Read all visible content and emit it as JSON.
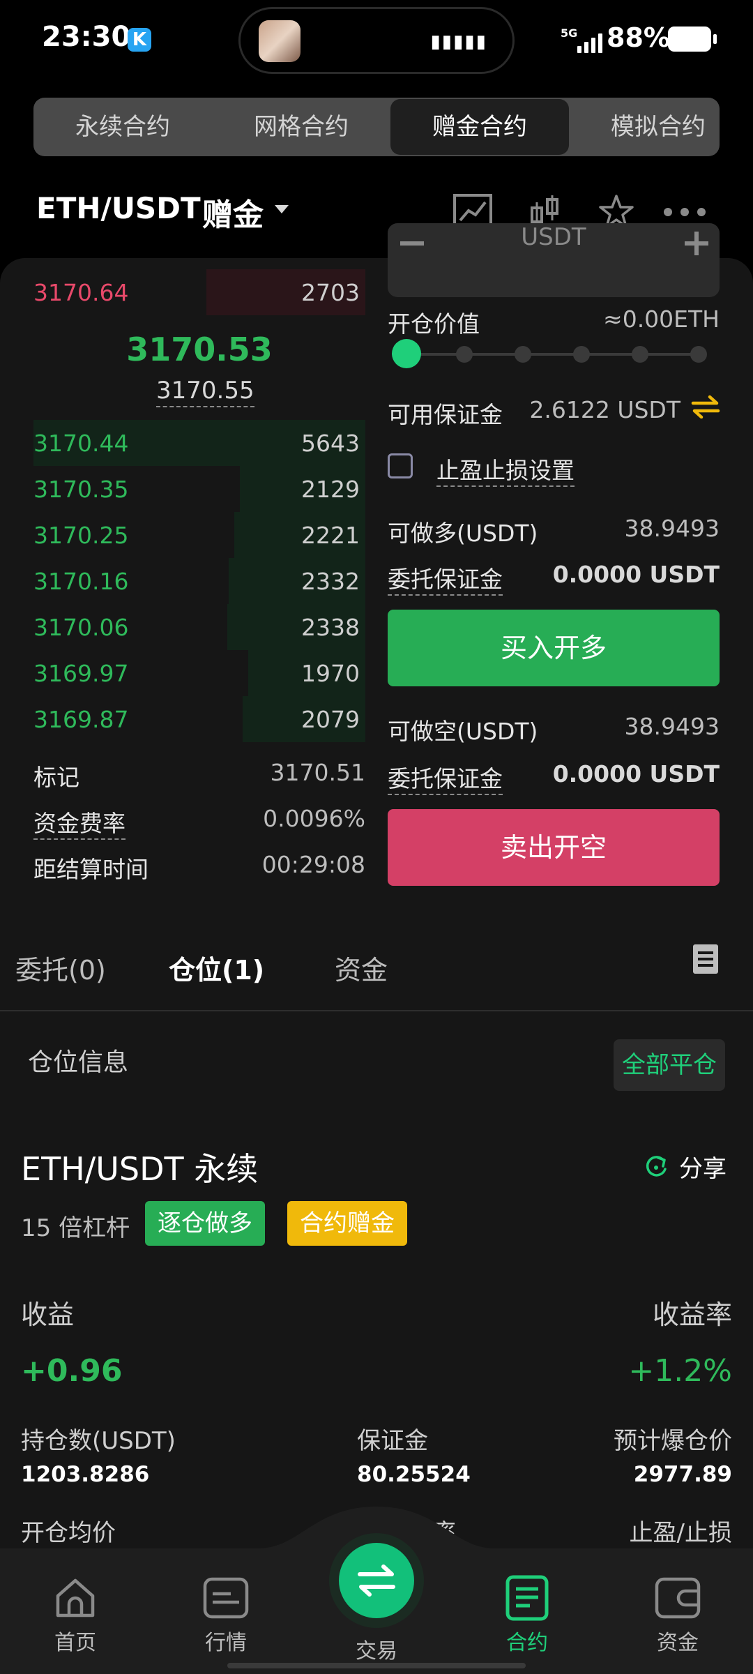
{
  "status_bar": {
    "time": "23:30",
    "net": "5G",
    "battery": "88%"
  },
  "top_tabs": [
    {
      "label": "永续合约",
      "active": false
    },
    {
      "label": "网格合约",
      "active": false
    },
    {
      "label": "赠金合约",
      "active": true
    },
    {
      "label": "模拟合约",
      "active": false
    }
  ],
  "pair": {
    "name": "ETH/USDT",
    "tag": "赠金"
  },
  "order_book": {
    "asks": [
      {
        "price": "3170.64",
        "qty": "2703"
      }
    ],
    "last_price": "3170.53",
    "mark_price": "3170.55",
    "bids": [
      {
        "price": "3170.44",
        "qty": "5643"
      },
      {
        "price": "3170.35",
        "qty": "2129"
      },
      {
        "price": "3170.25",
        "qty": "2221"
      },
      {
        "price": "3170.16",
        "qty": "2332"
      },
      {
        "price": "3170.06",
        "qty": "2338"
      },
      {
        "price": "3169.97",
        "qty": "1970"
      },
      {
        "price": "3169.87",
        "qty": "2079"
      }
    ]
  },
  "market_info": {
    "mark_label": "标记",
    "mark_value": "3170.51",
    "funding_label": "资金费率",
    "funding_value": "0.0096%",
    "settle_label": "距结算时间",
    "settle_value": "00:29:08"
  },
  "order_form": {
    "unit": "USDT",
    "open_value_label": "开仓价值",
    "open_value": "≈0.00ETH",
    "available_label": "可用保证金",
    "available_value": "2.6122 USDT",
    "tpsl_label": "止盈止损设置",
    "long_max_label": "可做多(USDT)",
    "long_max_value": "38.9493",
    "long_margin_label": "委托保证金",
    "long_margin_value": "0.0000 USDT",
    "buy_label": "买入开多",
    "short_max_label": "可做空(USDT)",
    "short_max_value": "38.9493",
    "short_margin_label": "委托保证金",
    "short_margin_value": "0.0000 USDT",
    "sell_label": "卖出开空",
    "slider_percent": 0
  },
  "section_tabs": [
    {
      "label": "委托(0)",
      "active": false
    },
    {
      "label": "仓位(1)",
      "active": true
    },
    {
      "label": "资金",
      "active": false
    }
  ],
  "position": {
    "section_title": "仓位信息",
    "close_all": "全部平仓",
    "pair": "ETH/USDT 永续",
    "share": "分享",
    "leverage": "15 倍杠杆",
    "badge_side": "逐仓做多",
    "badge_bonus": "合约赠金",
    "pnl_label": "收益",
    "pnl_value": "+0.96",
    "roe_label": "收益率",
    "roe_value": "+1.2%",
    "size_label": "持仓数(USDT)",
    "size_value": "1203.8286",
    "margin_label": "保证金",
    "margin_value": "80.25524",
    "liq_label": "预计爆仓价",
    "liq_value": "2977.89",
    "entry_label": "开仓均价",
    "mid_label_partial": "率",
    "tpsl_label": "止盈/止损"
  },
  "bottom_nav": [
    {
      "label": "首页",
      "icon": "home-icon"
    },
    {
      "label": "行情",
      "icon": "market-icon"
    },
    {
      "label": "交易",
      "icon": "swap-icon"
    },
    {
      "label": "合约",
      "icon": "contract-icon",
      "active": true
    },
    {
      "label": "资金",
      "icon": "wallet-icon"
    }
  ],
  "colors": {
    "green": "#2fba5b",
    "red": "#e8496a",
    "accent": "#1fcf7a",
    "buy": "#27ad55",
    "sell": "#d44066"
  }
}
